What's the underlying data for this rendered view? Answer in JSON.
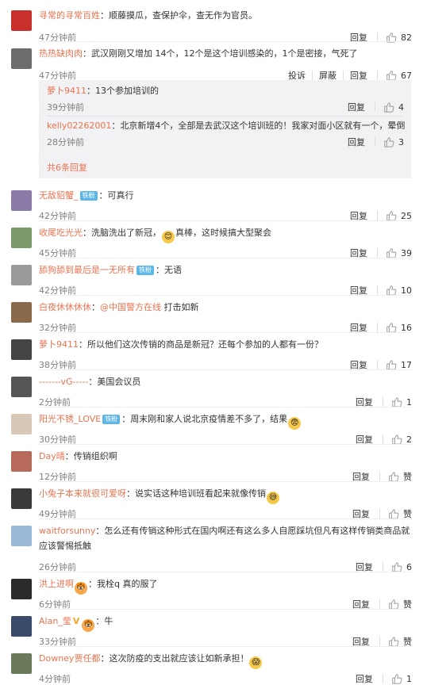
{
  "comments": [
    {
      "name": "寻常的寻常百姓",
      "badge": "",
      "sep": "：",
      "text": "顺藤摸瓜，查保护伞，查无作为官员。",
      "time": "47分钟前",
      "reply": "回复",
      "likes": "82",
      "avatar_color": "#c9302c"
    },
    {
      "name": "热热缺肉肉",
      "badge": "",
      "sep": "：",
      "text": "武汉刚刚又增加 14个，12个是这个培训感染的，1个是密接，气死了",
      "time": "47分钟前",
      "report": "投诉",
      "block": "屏蔽",
      "reply": "回复",
      "likes": "67",
      "avatar_color": "#6d6d6d"
    },
    {
      "name": "无敌貂蟹_",
      "badge": "铁粉",
      "sep": "：",
      "text": "可真行",
      "time": "42分钟前",
      "reply": "回复",
      "likes": "25",
      "avatar_color": "#8a7aa8"
    },
    {
      "name": "收尾吃光光",
      "badge": "",
      "sep": "：",
      "text": "洗脑洗出了新冠，",
      "emoji": "😊",
      "text2": "真棒，这时候搞大型聚会",
      "time": "45分钟前",
      "reply": "回复",
      "likes": "39",
      "avatar_color": "#7a9a6a"
    },
    {
      "name": "舔狗舔到最后是一无所有",
      "badge": "铁粉",
      "sep": "：",
      "text": "无语",
      "time": "42分钟前",
      "reply": "回复",
      "likes": "10",
      "avatar_color": "#9a9a9a"
    },
    {
      "name": "白夜休休休休",
      "badge": "",
      "sep": "：",
      "mention": "@中国警方在线",
      "text": " 打击如新",
      "time": "32分钟前",
      "reply": "回复",
      "likes": "16",
      "avatar_color": "#8a6a4a"
    },
    {
      "name": "萝卜9411",
      "badge": "",
      "sep": "：",
      "text": "所以他们这次传销的商品是新冠？还每个参加的人都有一份？",
      "time": "38分钟前",
      "reply": "回复",
      "likes": "17",
      "avatar_color": "#444444"
    },
    {
      "name": "-------vG-----",
      "badge": "",
      "sep": "：",
      "text": "美国会议员",
      "time": "2分钟前",
      "reply": "回复",
      "likes": "1",
      "avatar_color": "#555555"
    },
    {
      "name": "阳光不锈_LOVE",
      "badge": "铁粉",
      "sep": "：",
      "text": "周末刚和家人说北京疫情差不多了，结果",
      "emoji": "😨",
      "time": "30分钟前",
      "reply": "回复",
      "likes": "2",
      "avatar_color": "#d8c8b8"
    },
    {
      "name": "Day晴",
      "badge": "",
      "sep": "：",
      "text": "传销组织啊",
      "time": "12分钟前",
      "reply": "回复",
      "likes": "赞",
      "avatar_color": "#b86a5a"
    },
    {
      "name": "小兔子本来就很可爱呀",
      "badge": "",
      "sep": "：",
      "text": "说实话这种培训班看起来就像传销",
      "emoji": "😅",
      "time": "49分钟前",
      "reply": "回复",
      "likes": "赞",
      "avatar_color": "#3a3a3a"
    },
    {
      "name": "waitforsunny",
      "badge": "",
      "sep": "：",
      "text": "怎么还有传销这种形式在国内啊还有这么多人自愿踩坑但凡有这样传销类商品就应该警惕抵触",
      "time": "26分钟前",
      "reply": "回复",
      "likes": "6",
      "avatar_color": "#9ab8d8"
    },
    {
      "name": "洪上进啊",
      "badge": "",
      "sep": "：",
      "emoji_pre": "🐯",
      "text": "我栓q 真的服了",
      "time": "6分钟前",
      "reply": "回复",
      "likes": "赞",
      "avatar_color": "#2a2a2a"
    },
    {
      "name": "Alan_莹",
      "badge": "",
      "vbadge": "V",
      "sep": "：",
      "emoji_pre": "🐯",
      "text": "牛",
      "time": "33分钟前",
      "reply": "回复",
      "likes": "赞",
      "avatar_color": "#3a4a6a"
    },
    {
      "name": "Downey贾任都",
      "badge": "",
      "sep": "：",
      "text": "这次防疫的支出就应该让如新承担！",
      "emoji": "😱",
      "time": "4分钟前",
      "reply": "回复",
      "likes": "1",
      "avatar_color": "#6a7a5a"
    }
  ],
  "replies": [
    {
      "name": "萝卜9411",
      "sep": "：",
      "text": "13个参加培训的",
      "time": "39分钟前",
      "reply": "回复",
      "likes": "4"
    },
    {
      "name": "kelly02262001",
      "sep": "：",
      "text": "北京新增4个，全部是去武汉这个培训班的！我家对面小区就有一个，晕倒",
      "time": "28分钟前",
      "reply": "回复",
      "likes": "3"
    }
  ],
  "more_replies": "共6条回复"
}
